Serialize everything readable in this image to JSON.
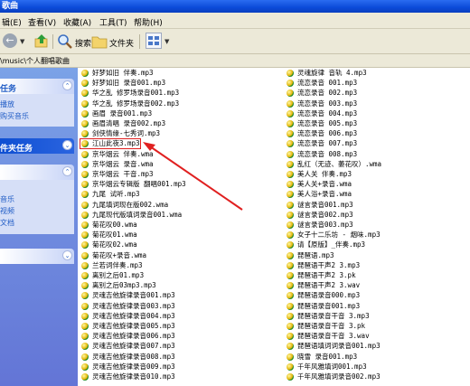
{
  "window": {
    "title": "歌曲"
  },
  "menu": [
    "辑(E)",
    "查看(V)",
    "收藏(A)",
    "工具(T)",
    "帮助(H)"
  ],
  "toolbar": {
    "search_label": "搜索",
    "folders_label": "文件夹"
  },
  "address": {
    "path": "\\music\\个人翻唱歌曲"
  },
  "left_panel": {
    "tasks_title": "任务",
    "tasks_links": [
      "播放",
      "购买音乐"
    ],
    "folder_tasks_title": "件夹任务",
    "other_links": [
      "音乐",
      "视频",
      "文档"
    ]
  },
  "files_left": [
    "好梦如旧 伴奏.mp3",
    "好梦如旧 录音001.mp3",
    "华之乱 修罗场录音001.mp3",
    "华之乱 修罗场录音002.mp3",
    "画眉 录音001.mp3",
    "画眉清唱 录音002.mp3",
    "剑侠情缘-七秀词.mp3",
    "江山此夜3.mp3",
    "京华烟云 伴奏.wma",
    "京华烟云 录音.wma",
    "京华烟云 干音.mp3",
    "京华烟云专辑版 翻唱001.mp3",
    "九尾 试听.mp3",
    "九尾填词现在版002.wma",
    "九尾现代版填词录音001.wma",
    "菊花叹00.wma",
    "菊花叹01.wma",
    "菊花叹02.wma",
    "菊花叹+录音.wma",
    "兰若词伴奏.mp3",
    "离别之后01.mp3",
    "离别之后03mp3.mp3",
    "灵魂吉他旋律录音001.mp3",
    "灵魂吉他旋律录音003.mp3",
    "灵魂吉他旋律录音004.mp3",
    "灵魂吉他旋律录音005.mp3",
    "灵魂吉他旋律录音006.mp3",
    "灵魂吉他旋律录音007.mp3",
    "灵魂吉他旋律录音008.mp3",
    "灵魂吉他旋律录音009.mp3",
    "灵魂吉他旋律录音010.mp3"
  ],
  "files_right": [
    "灵魂旋律 音轨 4.mp3",
    "流恋录音 001.mp3",
    "流恋录音 002.mp3",
    "流恋录音 003.mp3",
    "流恋录音 004.mp3",
    "流恋录音 005.mp3",
    "流恋录音 006.mp3",
    "流恋录音 007.mp3",
    "流恋录音 008.mp3",
    "乱红（无迹、萎花叹）.wma",
    "美人关 伴奏.mp3",
    "美人关+录音.wma",
    "美人浴+录音.wma",
    "谜言录音001.mp3",
    "谜言录音002.mp3",
    "谜言录音003.mp3",
    "女子十二乐坊 - 烟味.mp3",
    "请【原版】_伴奏.mp3",
    "琵琶语.mp3",
    "琵琶语干声2 3.mp3",
    "琵琶语干声2 3.pk",
    "琵琶语干声2 3.wav",
    "琵琶语录音000.mp3",
    "琵琶语录音001.mp3",
    "琵琶语录音干音 3.mp3",
    "琵琶语录音干音 3.pk",
    "琵琶语录音干音 3.wav",
    "琵琶语填词词录音001.mp3",
    "晓雪 录音001.mp3",
    "千年风雅填词001.mp3",
    "千年风雅填词录音002.mp3"
  ],
  "highlighted_file": "江山此夜3.mp3",
  "colors": {
    "highlight": "#e02020",
    "title_bar": "#0b4ad8",
    "left_pane": "#6f8fe0"
  }
}
